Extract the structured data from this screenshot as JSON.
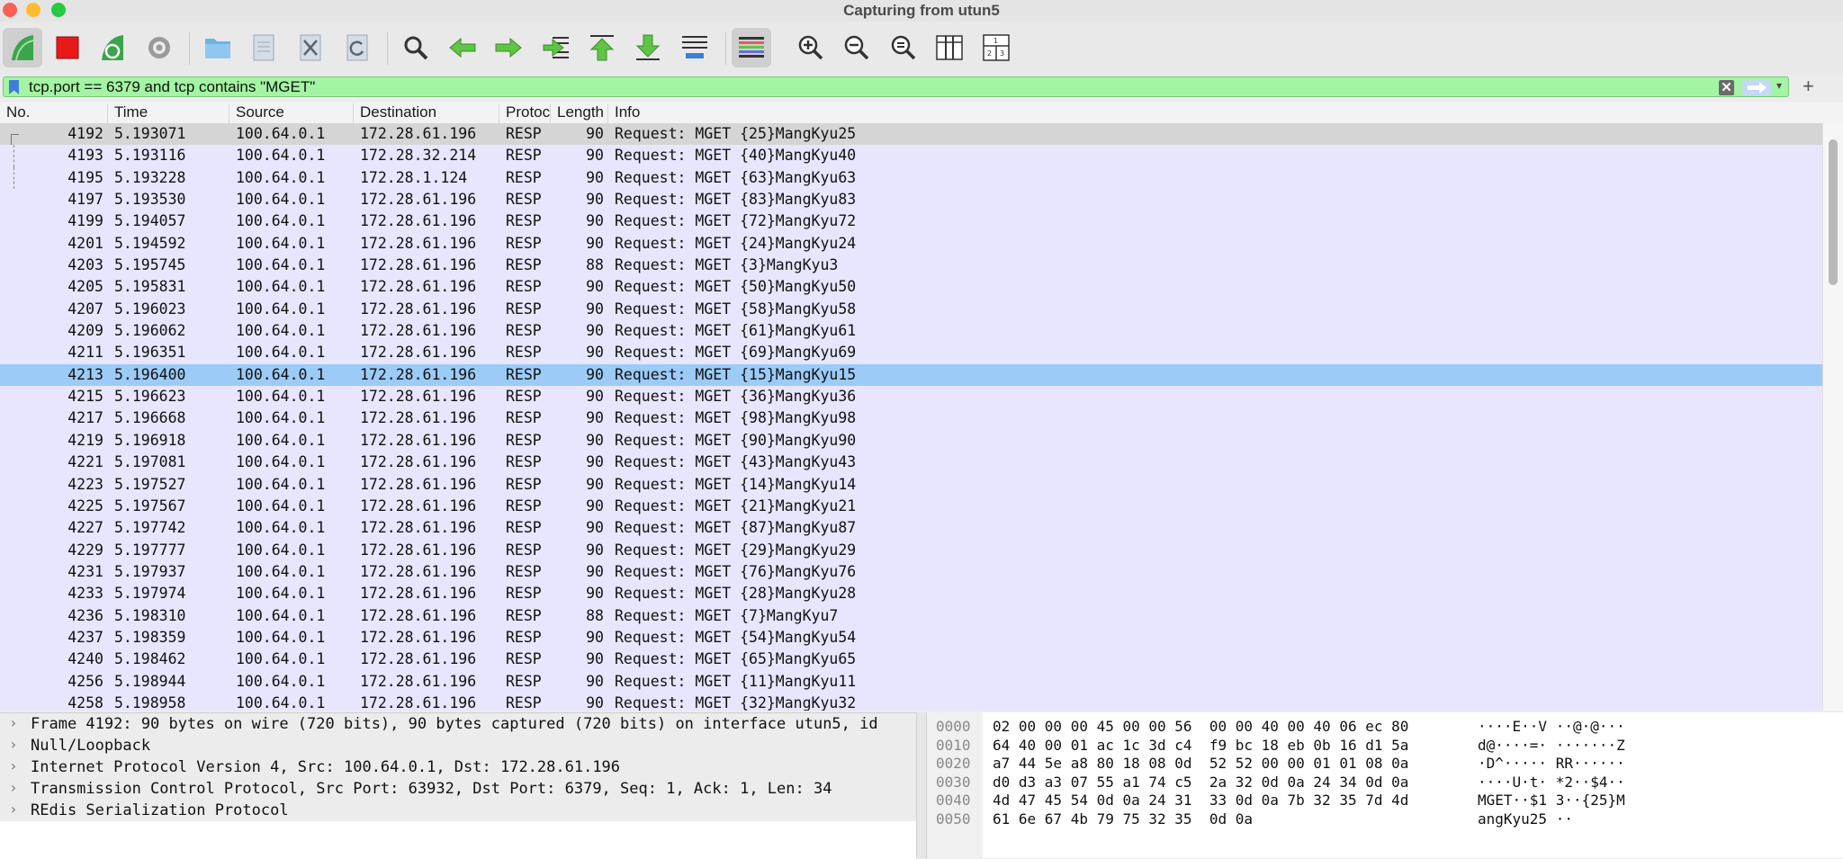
{
  "window": {
    "title": "Capturing from utun5"
  },
  "toolbar": {
    "icons": [
      "start-capture-icon",
      "stop-capture-icon",
      "restart-capture-icon",
      "capture-options-icon",
      "open-file-icon",
      "save-file-icon",
      "close-file-icon",
      "reload-file-icon",
      "find-packet-icon",
      "go-back-icon",
      "go-forward-icon",
      "go-to-packet-icon",
      "first-packet-icon",
      "last-packet-icon",
      "autoscroll-icon",
      "colorize-icon",
      "zoom-in-icon",
      "zoom-out-icon",
      "zoom-normal-icon",
      "resize-columns-icon",
      "layout-icon"
    ]
  },
  "filter": {
    "value": "tcp.port == 6379 and tcp contains \"MGET\"",
    "clear": "✕",
    "add": "+"
  },
  "columns": [
    "No.",
    "Time",
    "Source",
    "Destination",
    "Protocol",
    "Length",
    "Info"
  ],
  "packets": [
    {
      "no": "4192",
      "time": "5.193071",
      "src": "100.64.0.1",
      "dst": "172.28.61.196",
      "proto": "RESP",
      "len": "90",
      "info": "Request: MGET {25}MangKyu25"
    },
    {
      "no": "4193",
      "time": "5.193116",
      "src": "100.64.0.1",
      "dst": "172.28.32.214",
      "proto": "RESP",
      "len": "90",
      "info": "Request: MGET {40}MangKyu40"
    },
    {
      "no": "4195",
      "time": "5.193228",
      "src": "100.64.0.1",
      "dst": "172.28.1.124",
      "proto": "RESP",
      "len": "90",
      "info": "Request: MGET {63}MangKyu63"
    },
    {
      "no": "4197",
      "time": "5.193530",
      "src": "100.64.0.1",
      "dst": "172.28.61.196",
      "proto": "RESP",
      "len": "90",
      "info": "Request: MGET {83}MangKyu83"
    },
    {
      "no": "4199",
      "time": "5.194057",
      "src": "100.64.0.1",
      "dst": "172.28.61.196",
      "proto": "RESP",
      "len": "90",
      "info": "Request: MGET {72}MangKyu72"
    },
    {
      "no": "4201",
      "time": "5.194592",
      "src": "100.64.0.1",
      "dst": "172.28.61.196",
      "proto": "RESP",
      "len": "90",
      "info": "Request: MGET {24}MangKyu24"
    },
    {
      "no": "4203",
      "time": "5.195745",
      "src": "100.64.0.1",
      "dst": "172.28.61.196",
      "proto": "RESP",
      "len": "88",
      "info": "Request: MGET {3}MangKyu3"
    },
    {
      "no": "4205",
      "time": "5.195831",
      "src": "100.64.0.1",
      "dst": "172.28.61.196",
      "proto": "RESP",
      "len": "90",
      "info": "Request: MGET {50}MangKyu50"
    },
    {
      "no": "4207",
      "time": "5.196023",
      "src": "100.64.0.1",
      "dst": "172.28.61.196",
      "proto": "RESP",
      "len": "90",
      "info": "Request: MGET {58}MangKyu58"
    },
    {
      "no": "4209",
      "time": "5.196062",
      "src": "100.64.0.1",
      "dst": "172.28.61.196",
      "proto": "RESP",
      "len": "90",
      "info": "Request: MGET {61}MangKyu61"
    },
    {
      "no": "4211",
      "time": "5.196351",
      "src": "100.64.0.1",
      "dst": "172.28.61.196",
      "proto": "RESP",
      "len": "90",
      "info": "Request: MGET {69}MangKyu69"
    },
    {
      "no": "4213",
      "time": "5.196400",
      "src": "100.64.0.1",
      "dst": "172.28.61.196",
      "proto": "RESP",
      "len": "90",
      "info": "Request: MGET {15}MangKyu15"
    },
    {
      "no": "4215",
      "time": "5.196623",
      "src": "100.64.0.1",
      "dst": "172.28.61.196",
      "proto": "RESP",
      "len": "90",
      "info": "Request: MGET {36}MangKyu36"
    },
    {
      "no": "4217",
      "time": "5.196668",
      "src": "100.64.0.1",
      "dst": "172.28.61.196",
      "proto": "RESP",
      "len": "90",
      "info": "Request: MGET {98}MangKyu98"
    },
    {
      "no": "4219",
      "time": "5.196918",
      "src": "100.64.0.1",
      "dst": "172.28.61.196",
      "proto": "RESP",
      "len": "90",
      "info": "Request: MGET {90}MangKyu90"
    },
    {
      "no": "4221",
      "time": "5.197081",
      "src": "100.64.0.1",
      "dst": "172.28.61.196",
      "proto": "RESP",
      "len": "90",
      "info": "Request: MGET {43}MangKyu43"
    },
    {
      "no": "4223",
      "time": "5.197527",
      "src": "100.64.0.1",
      "dst": "172.28.61.196",
      "proto": "RESP",
      "len": "90",
      "info": "Request: MGET {14}MangKyu14"
    },
    {
      "no": "4225",
      "time": "5.197567",
      "src": "100.64.0.1",
      "dst": "172.28.61.196",
      "proto": "RESP",
      "len": "90",
      "info": "Request: MGET {21}MangKyu21"
    },
    {
      "no": "4227",
      "time": "5.197742",
      "src": "100.64.0.1",
      "dst": "172.28.61.196",
      "proto": "RESP",
      "len": "90",
      "info": "Request: MGET {87}MangKyu87"
    },
    {
      "no": "4229",
      "time": "5.197777",
      "src": "100.64.0.1",
      "dst": "172.28.61.196",
      "proto": "RESP",
      "len": "90",
      "info": "Request: MGET {29}MangKyu29"
    },
    {
      "no": "4231",
      "time": "5.197937",
      "src": "100.64.0.1",
      "dst": "172.28.61.196",
      "proto": "RESP",
      "len": "90",
      "info": "Request: MGET {76}MangKyu76"
    },
    {
      "no": "4233",
      "time": "5.197974",
      "src": "100.64.0.1",
      "dst": "172.28.61.196",
      "proto": "RESP",
      "len": "90",
      "info": "Request: MGET {28}MangKyu28"
    },
    {
      "no": "4236",
      "time": "5.198310",
      "src": "100.64.0.1",
      "dst": "172.28.61.196",
      "proto": "RESP",
      "len": "88",
      "info": "Request: MGET {7}MangKyu7"
    },
    {
      "no": "4237",
      "time": "5.198359",
      "src": "100.64.0.1",
      "dst": "172.28.61.196",
      "proto": "RESP",
      "len": "90",
      "info": "Request: MGET {54}MangKyu54"
    },
    {
      "no": "4240",
      "time": "5.198462",
      "src": "100.64.0.1",
      "dst": "172.28.61.196",
      "proto": "RESP",
      "len": "90",
      "info": "Request: MGET {65}MangKyu65"
    },
    {
      "no": "4256",
      "time": "5.198944",
      "src": "100.64.0.1",
      "dst": "172.28.61.196",
      "proto": "RESP",
      "len": "90",
      "info": "Request: MGET {11}MangKyu11"
    },
    {
      "no": "4258",
      "time": "5.198958",
      "src": "100.64.0.1",
      "dst": "172.28.61.196",
      "proto": "RESP",
      "len": "90",
      "info": "Request: MGET {32}MangKyu32"
    }
  ],
  "details": [
    "Frame 4192: 90 bytes on wire (720 bits), 90 bytes captured (720 bits) on interface utun5, id",
    "Null/Loopback",
    "Internet Protocol Version 4, Src: 100.64.0.1, Dst: 172.28.61.196",
    "Transmission Control Protocol, Src Port: 63932, Dst Port: 6379, Seq: 1, Ack: 1, Len: 34",
    "REdis Serialization Protocol"
  ],
  "hex": [
    {
      "offset": "0000",
      "bytes": "02 00 00 00 45 00 00 56  00 00 40 00 40 06 ec 80",
      "ascii": "····E··V ··@·@···"
    },
    {
      "offset": "0010",
      "bytes": "64 40 00 01 ac 1c 3d c4  f9 bc 18 eb 0b 16 d1 5a",
      "ascii": "d@····=· ·······Z"
    },
    {
      "offset": "0020",
      "bytes": "a7 44 5e a8 80 18 08 0d  52 52 00 00 01 01 08 0a",
      "ascii": "·D^····· RR······"
    },
    {
      "offset": "0030",
      "bytes": "d0 d3 a3 07 55 a1 74 c5  2a 32 0d 0a 24 34 0d 0a",
      "ascii": "····U·t· *2··$4··"
    },
    {
      "offset": "0040",
      "bytes": "4d 47 45 54 0d 0a 24 31  33 0d 0a 7b 32 35 7d 4d",
      "ascii": "MGET··$1 3··{25}M"
    },
    {
      "offset": "0050",
      "bytes": "61 6e 67 4b 79 75 32 35  0d 0a",
      "ascii": "angKyu25 ··"
    }
  ],
  "colors": {
    "row_bg": "#e7e6fe",
    "selected_bg": "#9ccbf7",
    "filter_valid": "#a3f5a3"
  }
}
